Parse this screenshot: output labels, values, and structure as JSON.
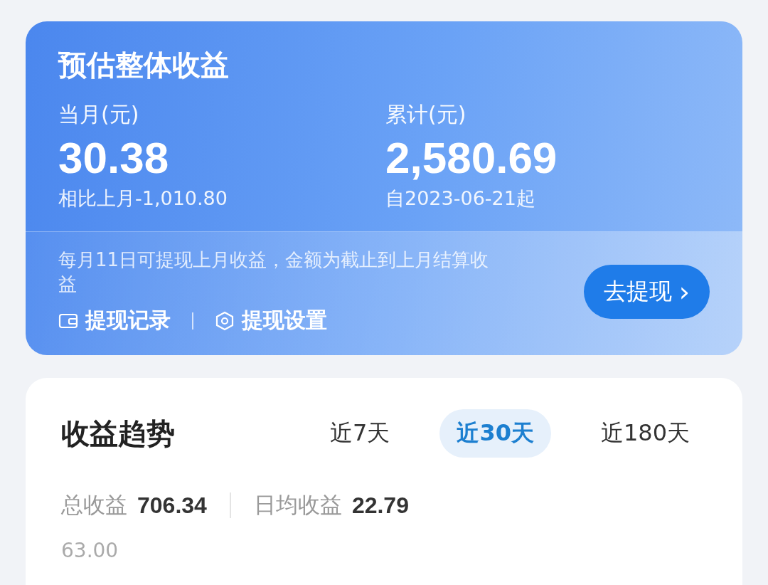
{
  "earnings_card": {
    "title": "预估整体收益",
    "stats": [
      {
        "label": "当月(元)",
        "value": "30.38",
        "note": "相比上月-1,010.80"
      },
      {
        "label": "累计(元)",
        "value": "2,580.69",
        "note": "自2023-06-21起"
      }
    ],
    "notice": "每月11日可提现上月收益，金额为截止到上月结算收益",
    "links": [
      {
        "kind": "wallet",
        "label": "提现记录"
      },
      {
        "kind": "settings",
        "label": "提现设置"
      }
    ],
    "withdraw_button": {
      "label": "去提现",
      "caret": "›"
    }
  },
  "trend_card": {
    "title": "收益趋势",
    "tabs": [
      {
        "label": "近7天",
        "selected": false
      },
      {
        "label": "近30天",
        "selected": true
      },
      {
        "label": "近180天",
        "selected": false
      }
    ],
    "summary": [
      {
        "label": "总收益",
        "value": "706.34"
      },
      {
        "label": "日均收益",
        "value": "22.79"
      }
    ],
    "axis_label": "63.00"
  }
}
